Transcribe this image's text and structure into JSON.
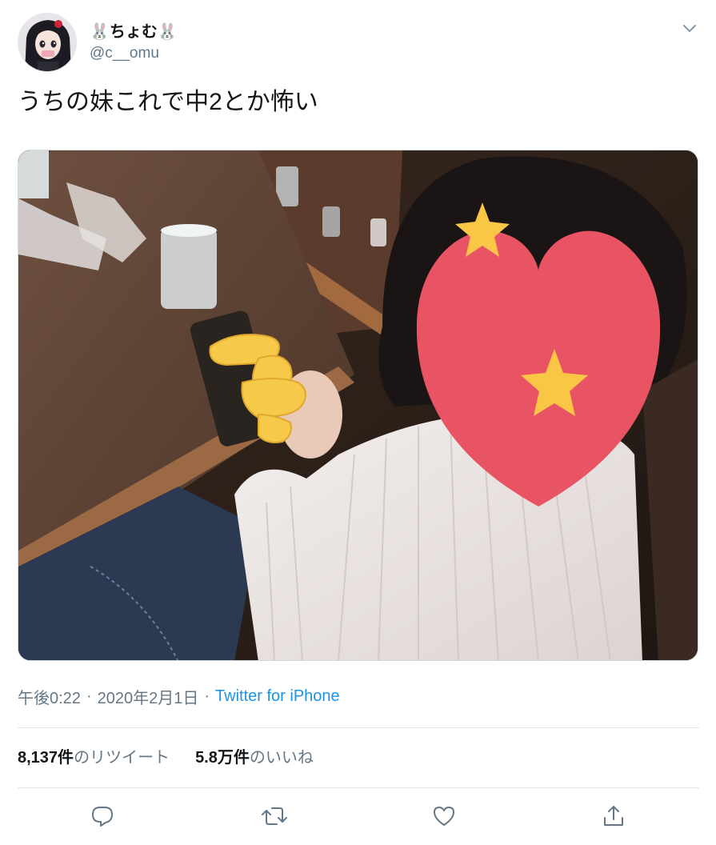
{
  "author": {
    "display_name": "🐰ちょむ🐰",
    "handle": "@c__omu"
  },
  "tweet": {
    "text": "うちの妹これで中2とか怖い",
    "time": "午後0:22",
    "date": "2020年2月1日",
    "separator": "·",
    "source": "Twitter for iPhone"
  },
  "stats": {
    "retweets_count": "8,137件",
    "retweets_label": "のリツイート",
    "likes_count": "5.8万件",
    "likes_label": "のいいね"
  },
  "icons": {
    "menu": "chevron-down-icon",
    "reply": "reply-icon",
    "retweet": "retweet-icon",
    "like": "heart-icon",
    "share": "share-icon"
  },
  "colors": {
    "text": "#14171a",
    "secondary": "#657786",
    "link": "#1b95e0",
    "divider": "#e1e8ed",
    "heart_sticker": "#e95464",
    "star_sticker": "#f9c646",
    "hand_emoji": "#f7c948"
  }
}
